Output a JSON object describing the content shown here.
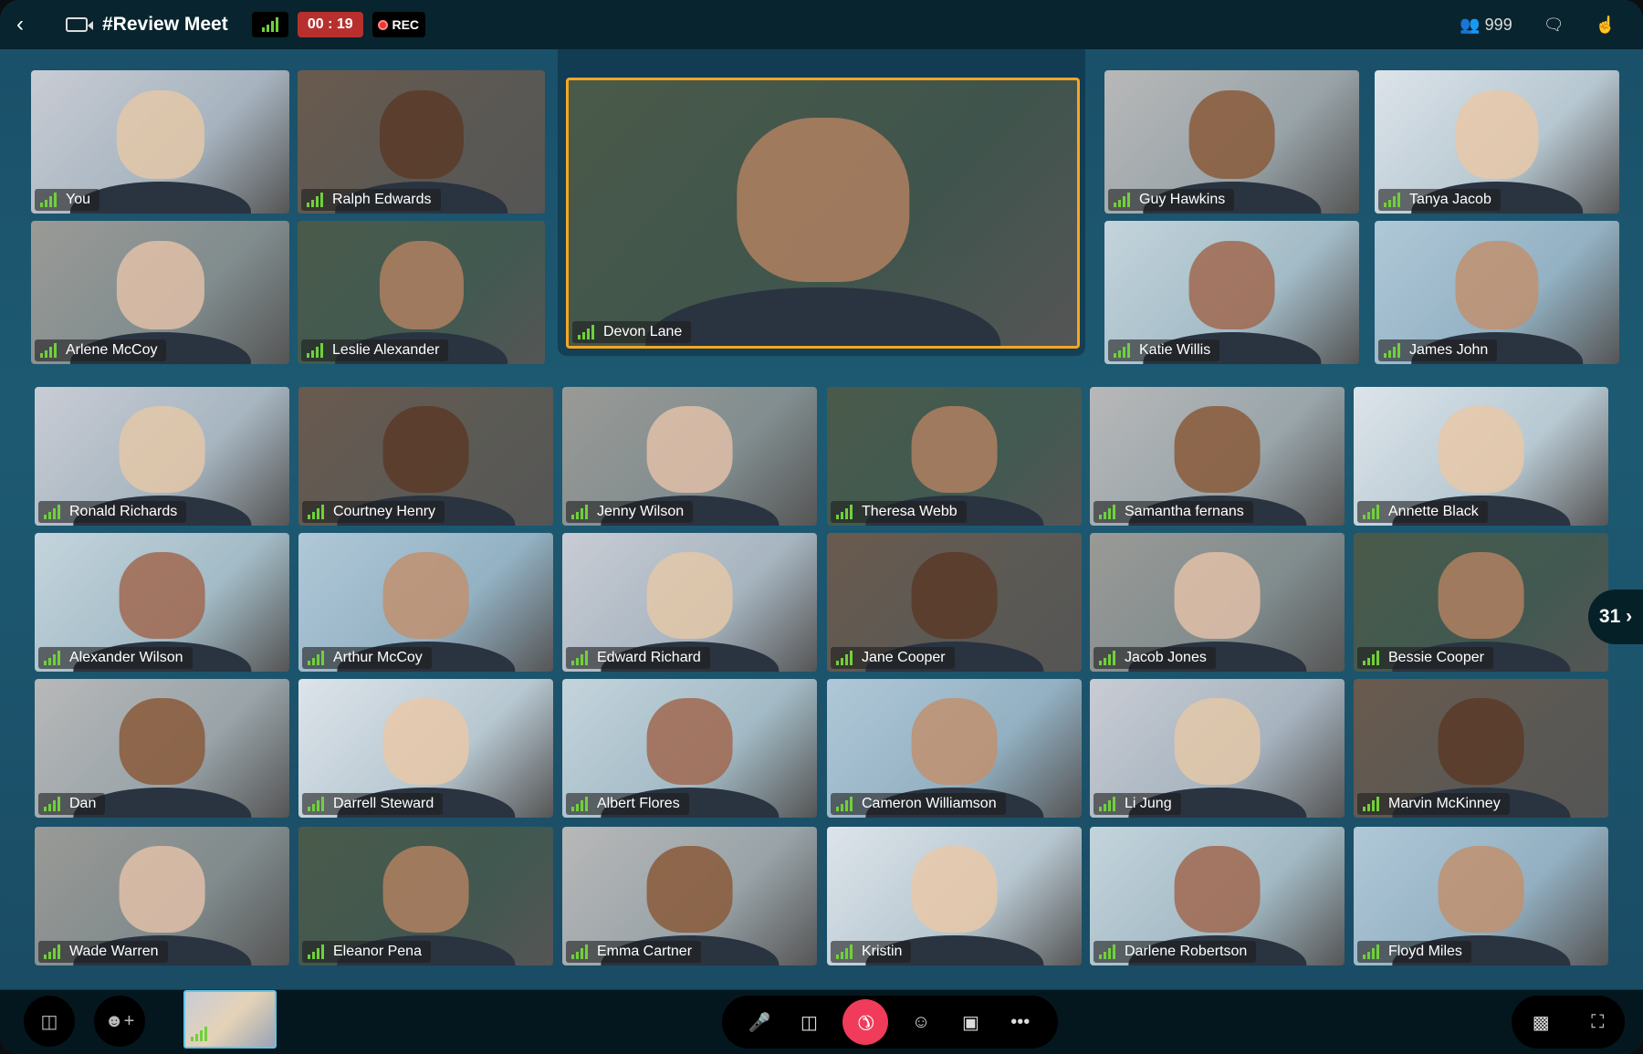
{
  "header": {
    "title": "#Review Meet",
    "timer": "00 : 19",
    "rec_label": "REC",
    "participant_count": "999",
    "icons": [
      "back-arrow-icon",
      "video-camera-icon",
      "signal-icon",
      "record-icon",
      "people-icon",
      "chat-icon",
      "raise-hand-icon"
    ]
  },
  "colors": {
    "accent": "#f5a623",
    "timer_bg": "#b8302e",
    "end_call": "#f03b5a",
    "signal": "#6fd13a",
    "self_view_border": "#5fc6e6"
  },
  "featured": {
    "name": "Devon Lane"
  },
  "participants": [
    {
      "name": "You"
    },
    {
      "name": "Ralph Edwards"
    },
    {
      "name": "Arlene McCoy"
    },
    {
      "name": "Leslie Alexander"
    },
    {
      "name": "Guy Hawkins"
    },
    {
      "name": "Tanya Jacob"
    },
    {
      "name": "Katie Willis"
    },
    {
      "name": "James John"
    },
    {
      "name": "Ronald Richards"
    },
    {
      "name": "Courtney Henry"
    },
    {
      "name": "Jenny Wilson"
    },
    {
      "name": "Theresa Webb"
    },
    {
      "name": "Samantha fernans"
    },
    {
      "name": "Annette Black"
    },
    {
      "name": "Alexander Wilson"
    },
    {
      "name": "Arthur McCoy"
    },
    {
      "name": "Edward Richard"
    },
    {
      "name": "Jane Cooper"
    },
    {
      "name": "Jacob Jones"
    },
    {
      "name": "Bessie Cooper"
    },
    {
      "name": "Dan"
    },
    {
      "name": "Darrell Steward"
    },
    {
      "name": "Albert Flores"
    },
    {
      "name": "Cameron Williamson"
    },
    {
      "name": "Li Jung"
    },
    {
      "name": "Marvin McKinney"
    },
    {
      "name": "Wade Warren"
    },
    {
      "name": "Eleanor Pena"
    },
    {
      "name": "Emma Cartner"
    },
    {
      "name": "Kristin"
    },
    {
      "name": "Darlene Robertson"
    },
    {
      "name": "Floyd Miles"
    }
  ],
  "pagination": {
    "remaining": "31"
  },
  "footer": {
    "controls": [
      "microphone-icon",
      "video-camera-icon",
      "end-call-icon",
      "emoji-icon",
      "screen-share-icon",
      "more-icon"
    ],
    "left": [
      "layout-icon",
      "add-participant-icon"
    ],
    "right": [
      "picture-in-picture-icon",
      "fullscreen-icon"
    ]
  }
}
